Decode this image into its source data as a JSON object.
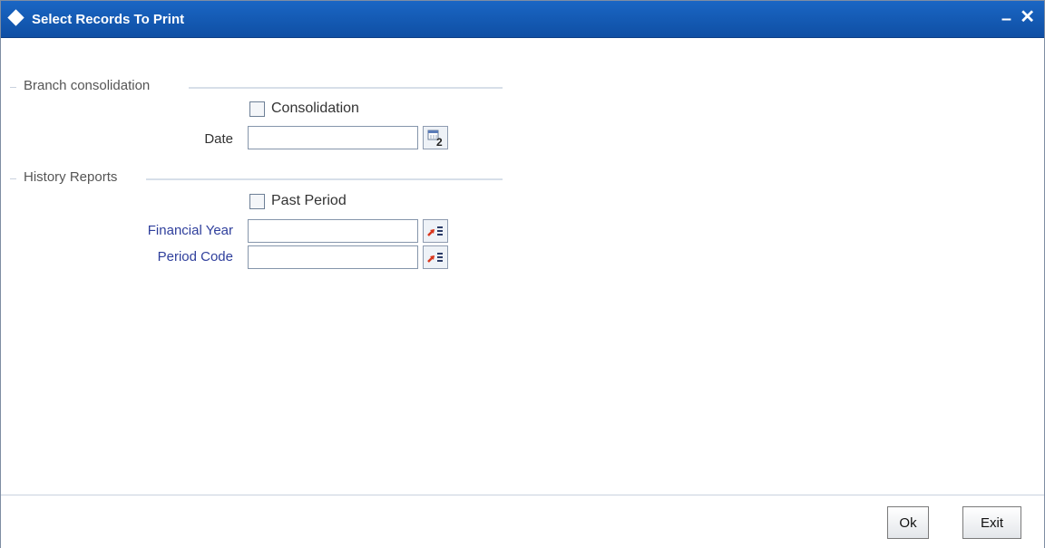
{
  "window": {
    "title": "Select Records To Print",
    "minimize_glyph": "–",
    "close_glyph": "✕"
  },
  "branch_consolidation": {
    "heading": "Branch consolidation",
    "consolidation_checkbox": {
      "label": "Consolidation",
      "checked": false
    },
    "date": {
      "label": "Date",
      "value": "",
      "button_icon": "calendar-icon"
    }
  },
  "history_reports": {
    "heading": "History Reports",
    "past_period_checkbox": {
      "label": "Past Period",
      "checked": false
    },
    "financial_year": {
      "label": "Financial Year",
      "value": "",
      "button_icon": "list-of-values-icon"
    },
    "period_code": {
      "label": "Period Code",
      "value": "",
      "button_icon": "list-of-values-icon"
    }
  },
  "footer": {
    "ok_label": "Ok",
    "exit_label": "Exit"
  },
  "colors": {
    "titlebar": "#1a66c4",
    "blue_label": "#2f3f9c",
    "section_line": "#d7dfe9"
  }
}
